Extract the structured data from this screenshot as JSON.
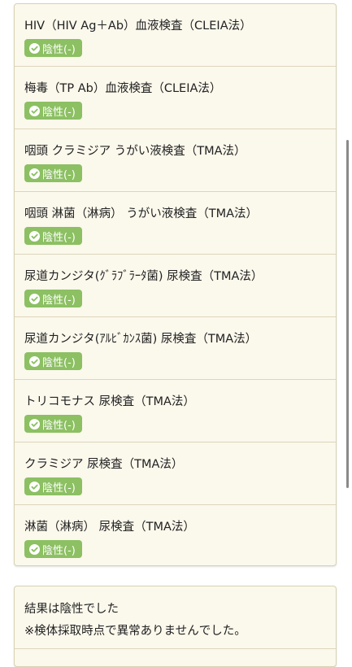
{
  "tests": [
    {
      "name": "HIV（HIV Ag＋Ab）血液検査（CLEIA法）",
      "result": "陰性(-)"
    },
    {
      "name": "梅毒（TP Ab）血液検査（CLEIA法）",
      "result": "陰性(-)"
    },
    {
      "name": "咽頭 クラミジア うがい液検査（TMA法）",
      "result": "陰性(-)"
    },
    {
      "name": "咽頭 淋菌（淋病） うがい液検査（TMA法）",
      "result": "陰性(-)"
    },
    {
      "name": "尿道カンジタ(ｸﾞﾗﾌﾞﾗｰﾀ菌) 尿検査（TMA法）",
      "result": "陰性(-)"
    },
    {
      "name": "尿道カンジタ(ｱﾙﾋﾞｶﾝｽ菌) 尿検査（TMA法）",
      "result": "陰性(-)"
    },
    {
      "name": "トリコモナス 尿検査（TMA法）",
      "result": "陰性(-)"
    },
    {
      "name": "クラミジア 尿検査（TMA法）",
      "result": "陰性(-)"
    },
    {
      "name": "淋菌（淋病） 尿検査（TMA法）",
      "result": "陰性(-)"
    }
  ],
  "summary": {
    "line1": "結果は陰性でした",
    "line2": "※検体採取時点で異常ありませんでした。"
  },
  "colors": {
    "badge": "#8cc063",
    "card_background": "#fbf8ec",
    "card_border": "#d9d2b4"
  },
  "icons": {
    "badge": "check-circle-icon"
  }
}
